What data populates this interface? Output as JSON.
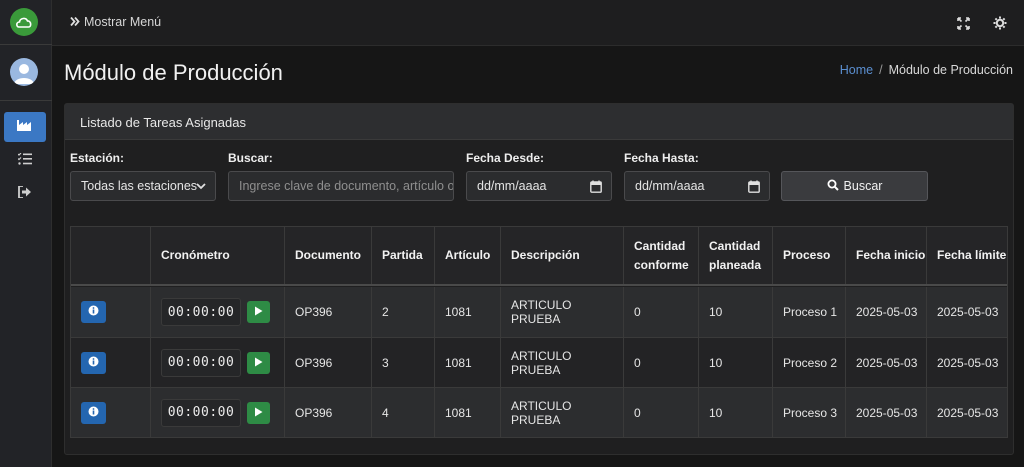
{
  "topbar": {
    "menu_toggle_label": "Mostrar Menú"
  },
  "page": {
    "title": "Módulo de Producción",
    "breadcrumb": {
      "home": "Home",
      "separator": "/",
      "current": "Módulo de Producción"
    }
  },
  "card": {
    "title": "Listado de Tareas Asignadas"
  },
  "filters": {
    "station_label": "Estación:",
    "station_value": "Todas las estaciones",
    "search_label": "Buscar:",
    "search_placeholder": "Ingrese clave de documento, artículo o",
    "date_from_label": "Fecha Desde:",
    "date_from_value": "dd/mm/aaaa",
    "date_to_label": "Fecha Hasta:",
    "date_to_value": "dd/mm/aaaa",
    "search_button": "Buscar"
  },
  "table": {
    "headers": [
      "",
      "Cronómetro",
      "Documento",
      "Partida",
      "Artículo",
      "Descripción",
      "Cantidad conforme",
      "Cantidad planeada",
      "Proceso",
      "Fecha inicio",
      "Fecha límite"
    ],
    "rows": [
      {
        "timer": "00:00:00",
        "documento": "OP396",
        "partida": "2",
        "articulo": "1081",
        "descripcion": "ARTICULO PRUEBA",
        "conforme": "0",
        "planeada": "10",
        "proceso": "Proceso 1",
        "inicio": "2025-05-03",
        "limite": "2025-05-03"
      },
      {
        "timer": "00:00:00",
        "documento": "OP396",
        "partida": "3",
        "articulo": "1081",
        "descripcion": "ARTICULO PRUEBA",
        "conforme": "0",
        "planeada": "10",
        "proceso": "Proceso 2",
        "inicio": "2025-05-03",
        "limite": "2025-05-03"
      },
      {
        "timer": "00:00:00",
        "documento": "OP396",
        "partida": "4",
        "articulo": "1081",
        "descripcion": "ARTICULO PRUEBA",
        "conforme": "0",
        "planeada": "10",
        "proceso": "Proceso 3",
        "inicio": "2025-05-03",
        "limite": "2025-05-03"
      }
    ]
  },
  "colors": {
    "accent": "#3b78c4",
    "info_button": "#2466b0",
    "play_button": "#2e8b45",
    "logo": "#3a9a3a"
  },
  "icons": {
    "sidebar": [
      "factory-icon",
      "task-list-icon",
      "logout-icon"
    ],
    "topbar": [
      "expand-icon",
      "gear-icon"
    ]
  }
}
